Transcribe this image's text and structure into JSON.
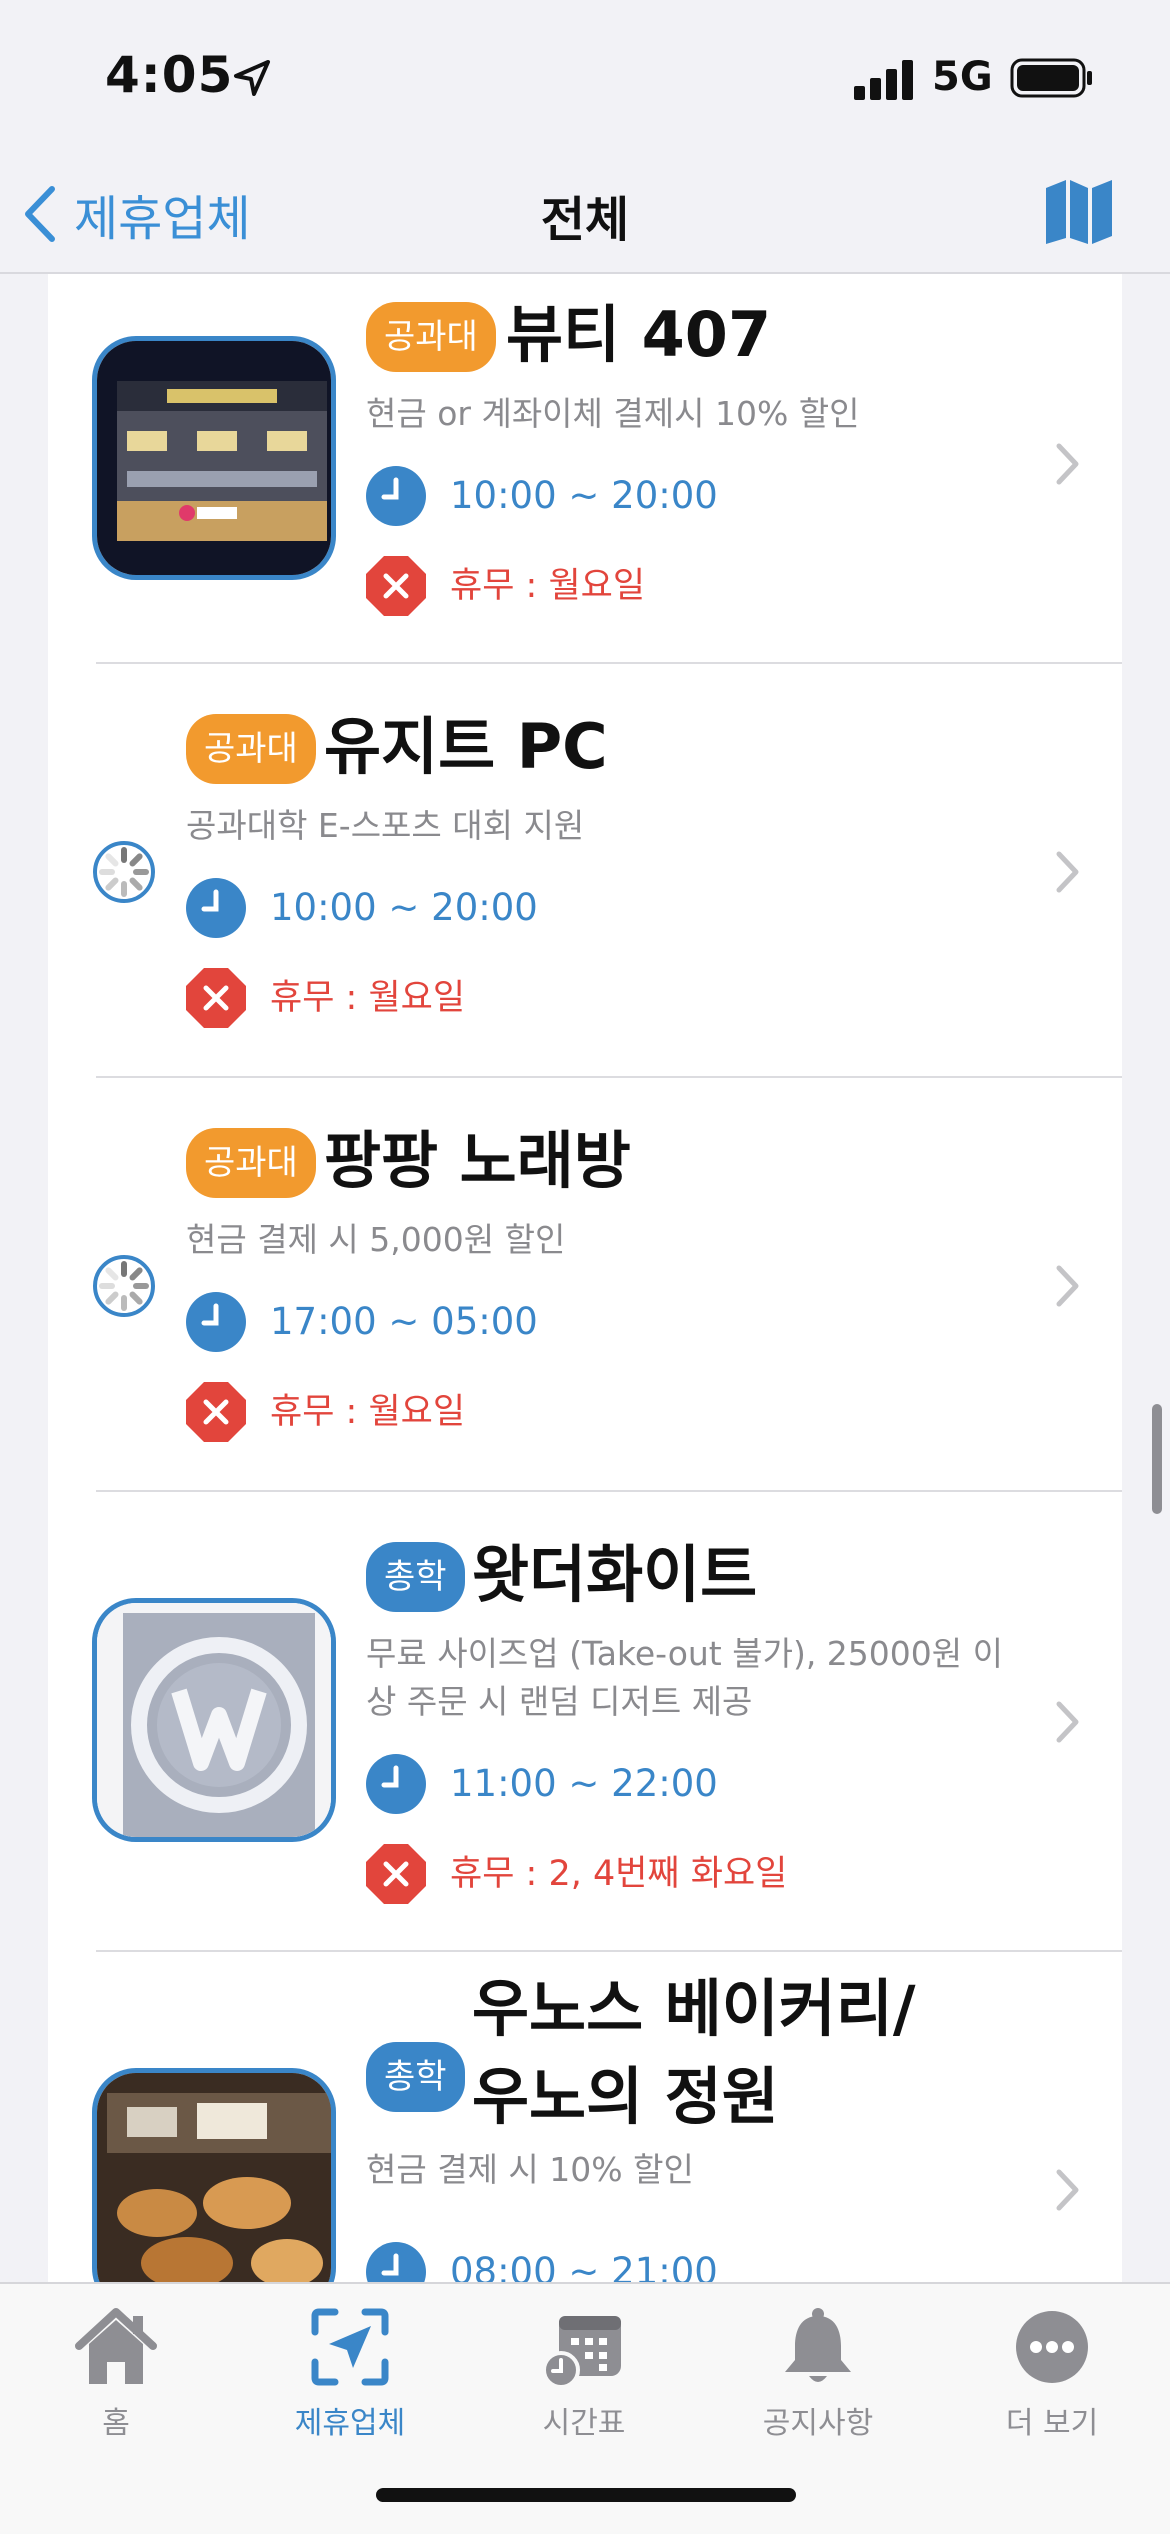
{
  "status_bar": {
    "time": "4:05",
    "network": "5G"
  },
  "nav": {
    "back_label": "제휴업체",
    "title": "전체"
  },
  "partners": [
    {
      "badge": "공과대",
      "badge_color": "#f29a2e",
      "name": "뷰티 407",
      "desc": "현금 or 계좌이체 결제시 10% 할인",
      "hours": "10:00 ~ 20:00",
      "closed": "휴무 : 월요일",
      "has_photo": true
    },
    {
      "badge": "공과대",
      "badge_color": "#f29a2e",
      "name": "유지트 PC",
      "desc": "공과대학 E-스포츠 대회 지원",
      "hours": "10:00 ~ 20:00",
      "closed": "휴무 : 월요일",
      "has_photo": false
    },
    {
      "badge": "공과대",
      "badge_color": "#f29a2e",
      "name": "팡팡 노래방",
      "desc": "현금 결제 시 5,000원 할인",
      "hours": "17:00 ~ 05:00",
      "closed": "휴무 : 월요일",
      "has_photo": false
    },
    {
      "badge": "총학",
      "badge_color": "#3a86c8",
      "name": "왓더화이트",
      "desc": "무료 사이즈업 (Take-out 불가), 25000원 이상 주문 시 랜덤 디저트 제공",
      "hours": "11:00 ~ 22:00",
      "closed": "휴무 : 2, 4번째 화요일",
      "has_photo": true
    },
    {
      "badge": "총학",
      "badge_color": "#3a86c8",
      "name_line1": "우노스 베이커리/",
      "name_line2": "우노의 정원",
      "desc": "현금 결제 시 10% 할인",
      "hours": "08:00 ~ 21:00",
      "has_photo": true
    }
  ],
  "tabs": [
    {
      "label": "홈",
      "icon": "home-icon",
      "active": false
    },
    {
      "label": "제휴업체",
      "icon": "partner-map-icon",
      "active": true
    },
    {
      "label": "시간표",
      "icon": "timetable-icon",
      "active": false
    },
    {
      "label": "공지사항",
      "icon": "bell-icon",
      "active": false
    },
    {
      "label": "더 보기",
      "icon": "more-icon",
      "active": false
    }
  ],
  "colors": {
    "accent": "#3a86c8",
    "orange_badge": "#f29a2e",
    "closed_red": "#e2453c",
    "hours_blue": "#3a86c8"
  }
}
